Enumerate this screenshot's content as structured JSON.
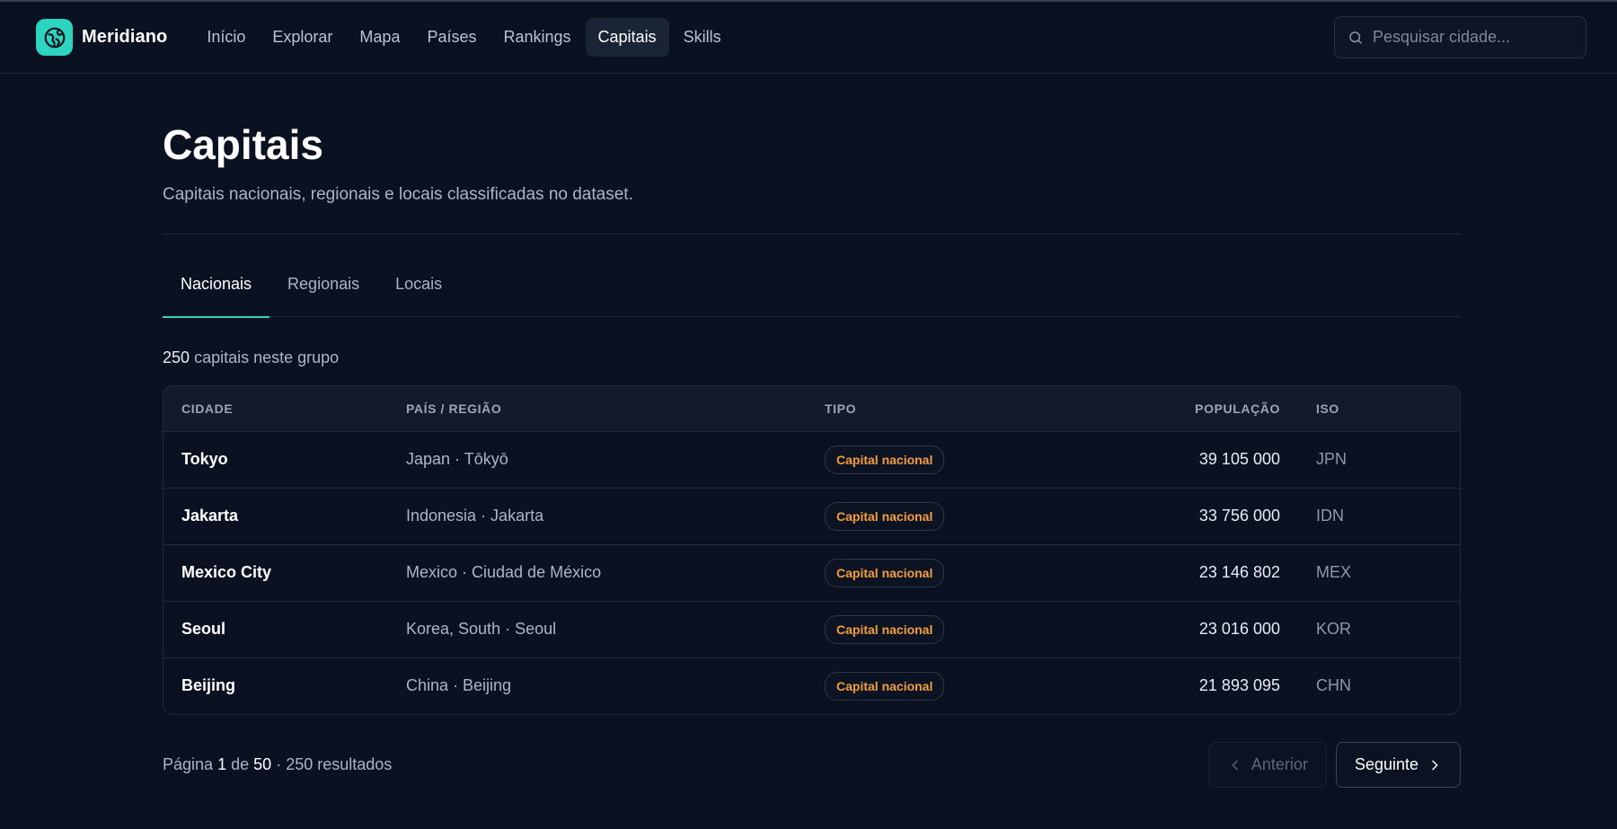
{
  "header": {
    "brand": "Meridiano",
    "nav": [
      {
        "label": "Início",
        "active": false
      },
      {
        "label": "Explorar",
        "active": false
      },
      {
        "label": "Mapa",
        "active": false
      },
      {
        "label": "Países",
        "active": false
      },
      {
        "label": "Rankings",
        "active": false
      },
      {
        "label": "Capitais",
        "active": true
      },
      {
        "label": "Skills",
        "active": false
      }
    ],
    "search_placeholder": "Pesquisar cidade..."
  },
  "page": {
    "title": "Capitais",
    "subtitle": "Capitais nacionais, regionais e locais classificadas no dataset."
  },
  "tabs": [
    {
      "label": "Nacionais",
      "active": true
    },
    {
      "label": "Regionais",
      "active": false
    },
    {
      "label": "Locais",
      "active": false
    }
  ],
  "summary": {
    "count": "250",
    "suffix": "capitais neste grupo"
  },
  "table": {
    "columns": [
      "CIDADE",
      "PAÍS / REGIÃO",
      "TIPO",
      "POPULAÇÃO",
      "ISO"
    ],
    "rows": [
      {
        "city": "Tokyo",
        "region": "Japan · Tōkyō",
        "type": "Capital nacional",
        "population": "39 105 000",
        "iso": "JPN"
      },
      {
        "city": "Jakarta",
        "region": "Indonesia · Jakarta",
        "type": "Capital nacional",
        "population": "33 756 000",
        "iso": "IDN"
      },
      {
        "city": "Mexico City",
        "region": "Mexico · Ciudad de México",
        "type": "Capital nacional",
        "population": "23 146 802",
        "iso": "MEX"
      },
      {
        "city": "Seoul",
        "region": "Korea, South · Seoul",
        "type": "Capital nacional",
        "population": "23 016 000",
        "iso": "KOR"
      },
      {
        "city": "Beijing",
        "region": "China · Beijing",
        "type": "Capital nacional",
        "population": "21 893 095",
        "iso": "CHN"
      }
    ]
  },
  "pagination": {
    "page_label": "Página",
    "current": "1",
    "of_label": "de",
    "total_pages": "50",
    "results": "· 250 resultados",
    "prev_label": "Anterior",
    "next_label": "Seguinte"
  },
  "colors": {
    "accent": "#2dd4bf",
    "badge": "#f59e3b",
    "background": "#0a1120"
  },
  "icons": {
    "logo": "globe-icon",
    "search": "search-icon",
    "prev": "chevron-left-icon",
    "next": "chevron-right-icon"
  }
}
